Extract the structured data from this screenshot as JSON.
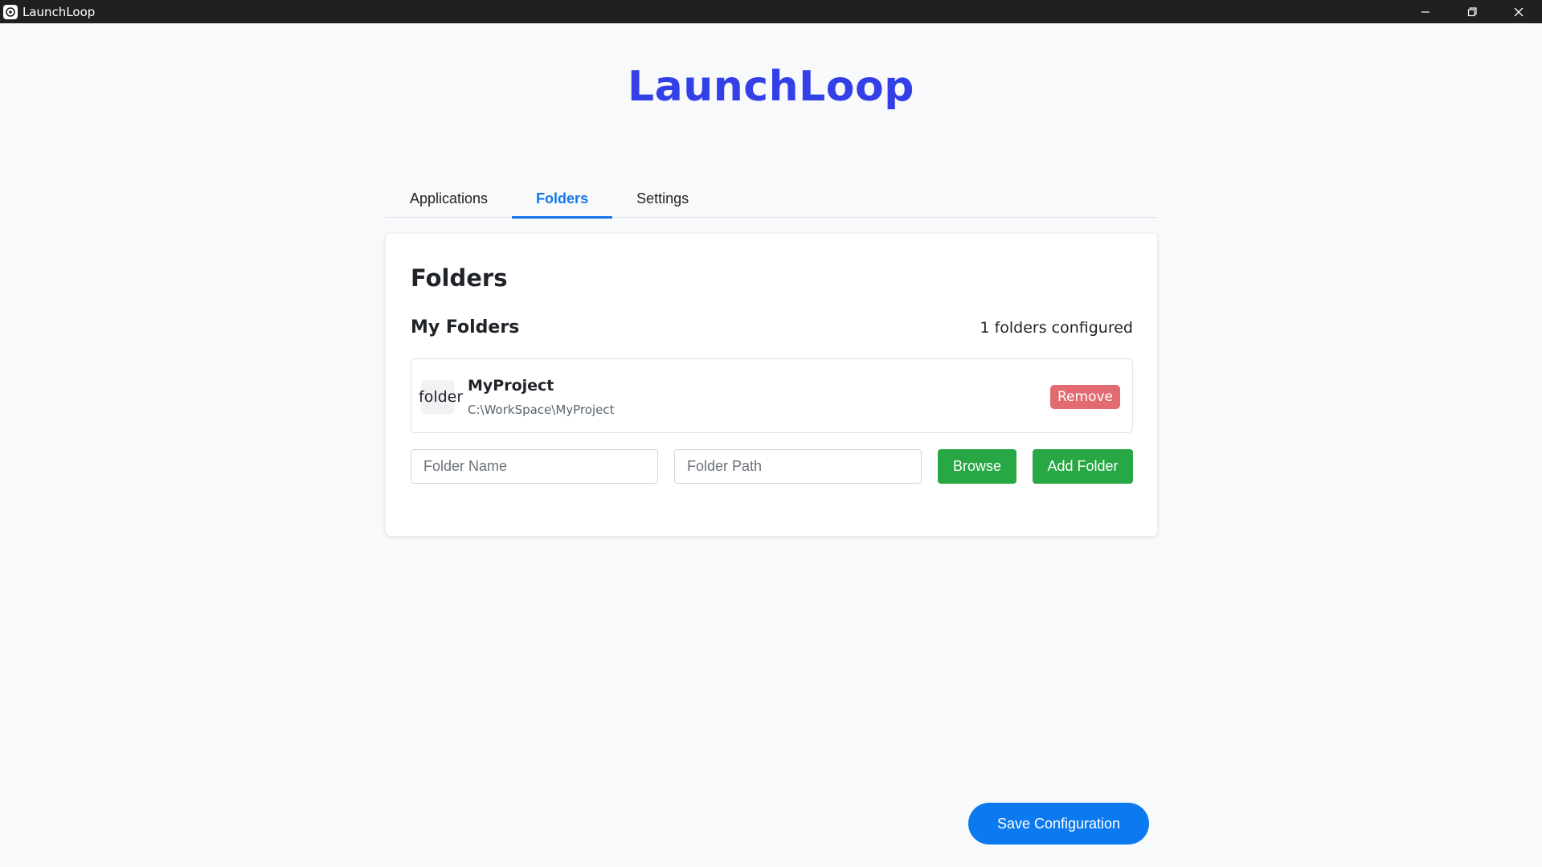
{
  "window": {
    "title": "LaunchLoop",
    "icon": "app-logo-icon",
    "controls": [
      "minimize-icon",
      "restore-icon",
      "close-icon"
    ]
  },
  "header": {
    "brand": "LaunchLoop",
    "brand_color": "#3340e8"
  },
  "tabs": [
    {
      "label": "Applications",
      "active": false
    },
    {
      "label": "Folders",
      "active": true
    },
    {
      "label": "Settings",
      "active": false
    }
  ],
  "panel": {
    "title": "Folders",
    "subtitle": "My Folders",
    "count_text": "1 folders configured",
    "folders": [
      {
        "icon_label": "folder",
        "name": "MyProject",
        "path": "C:\\WorkSpace\\MyProject",
        "remove_label": "Remove"
      }
    ],
    "form": {
      "name_placeholder": "Folder Name",
      "name_value": "",
      "path_placeholder": "Folder Path",
      "path_value": "",
      "browse_label": "Browse",
      "add_label": "Add Folder"
    }
  },
  "footer": {
    "save_label": "Save Configuration"
  },
  "colors": {
    "accent": "#1677e8",
    "success": "#28a745",
    "danger": "#e26b72",
    "primary": "#0b7af0"
  }
}
